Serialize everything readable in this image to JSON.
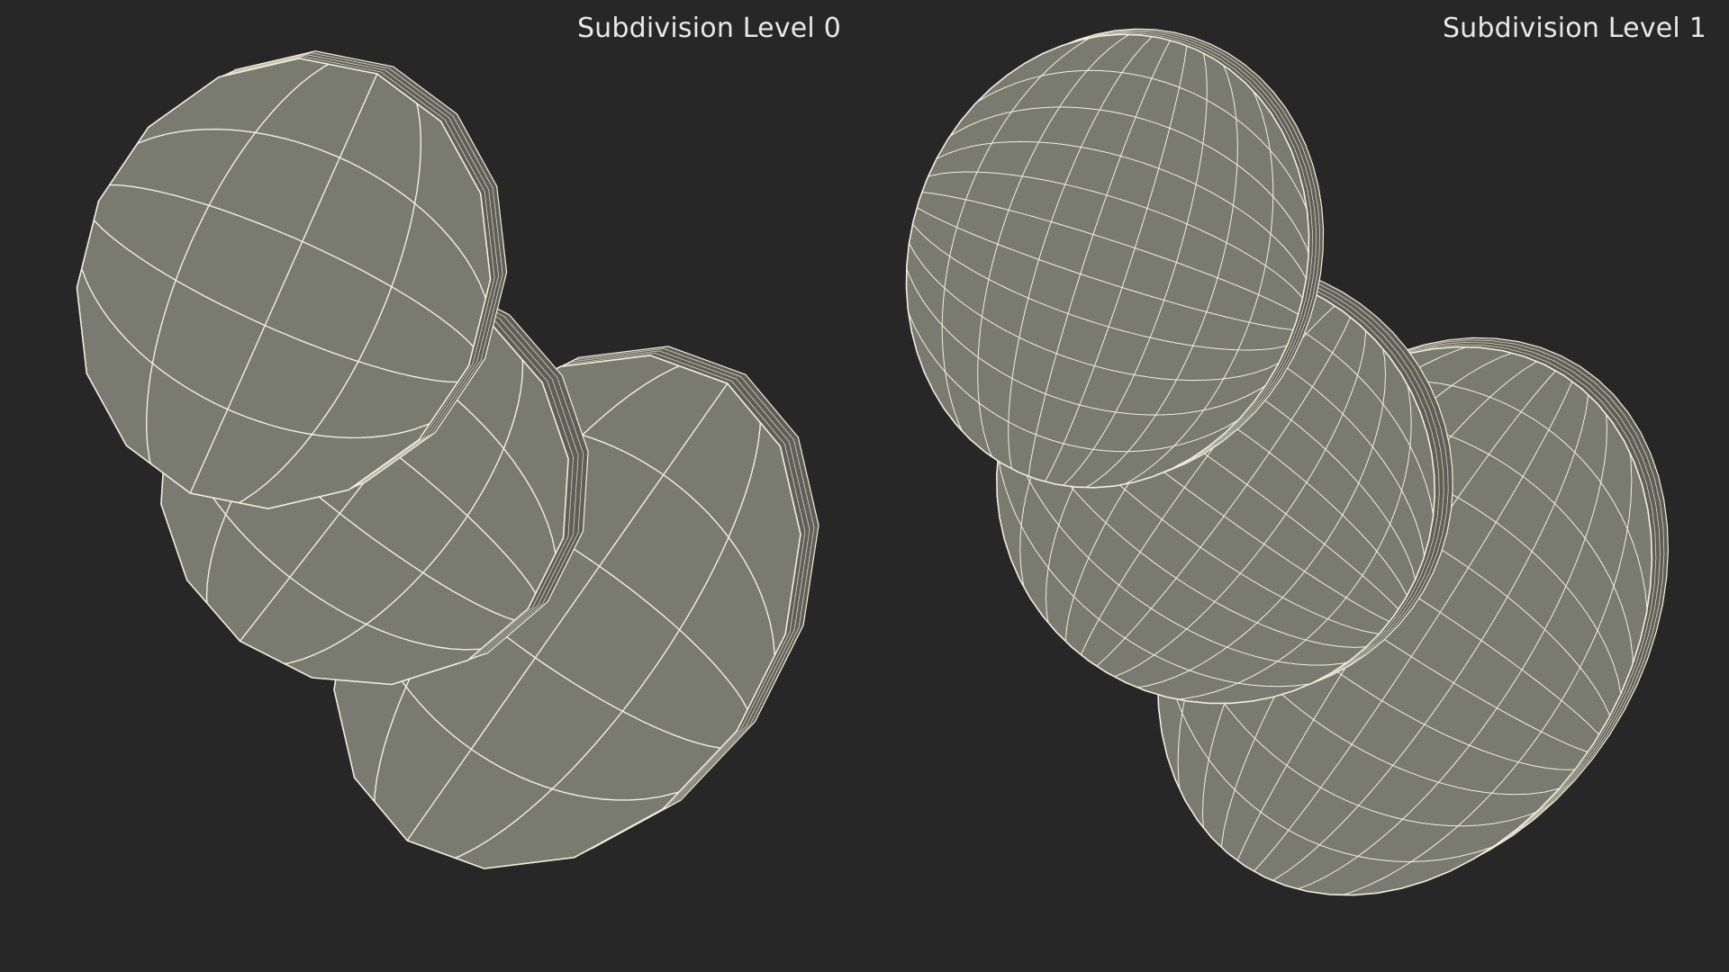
{
  "panels": {
    "left": {
      "caption": "Subdivision Level 0",
      "grid_cols": 4,
      "grid_rows": 5
    },
    "right": {
      "caption": "Subdivision Level 1",
      "grid_cols": 9,
      "grid_rows": 11
    }
  },
  "colors": {
    "background": "#272727",
    "face": "#797a70",
    "rim": "#5e5f57",
    "wire": "#f2f0dc"
  }
}
